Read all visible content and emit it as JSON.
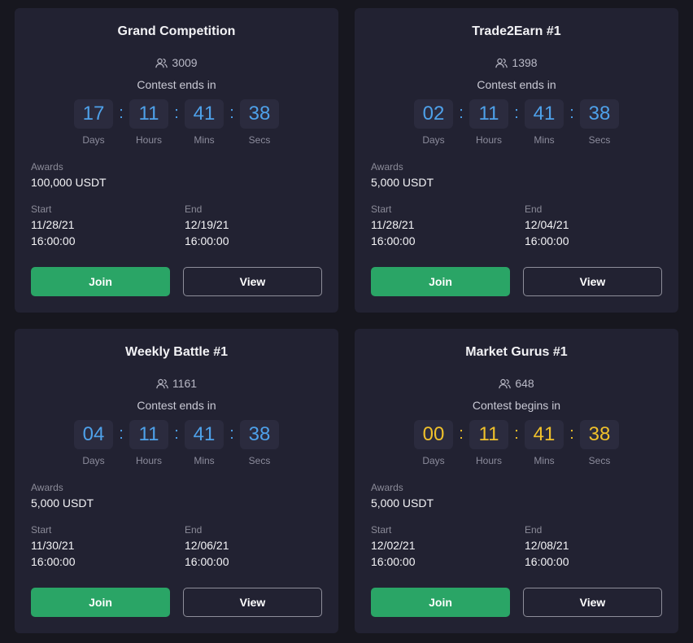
{
  "labels": {
    "awards": "Awards",
    "start": "Start",
    "end": "End",
    "days": "Days",
    "hours": "Hours",
    "mins": "Mins",
    "secs": "Secs",
    "join": "Join",
    "view": "View",
    "separator": ":"
  },
  "colors": {
    "background": "#17171f",
    "card": "#222232",
    "timer_box": "#2b2b3e",
    "countdown_blue": "#4ea1ea",
    "countdown_yellow": "#f0c12b",
    "join_button": "#2aa566"
  },
  "icons": {
    "participants": "users-icon"
  },
  "contests": [
    {
      "title": "Grand Competition",
      "participants": "3009",
      "status": "Contest ends in",
      "countdown_color": "blue",
      "countdown": {
        "days": "17",
        "hours": "11",
        "mins": "41",
        "secs": "38"
      },
      "awards": "100,000 USDT",
      "start_date": "11/28/21",
      "start_time": "16:00:00",
      "end_date": "12/19/21",
      "end_time": "16:00:00"
    },
    {
      "title": "Trade2Earn #1",
      "participants": "1398",
      "status": "Contest ends in",
      "countdown_color": "blue",
      "countdown": {
        "days": "02",
        "hours": "11",
        "mins": "41",
        "secs": "38"
      },
      "awards": "5,000 USDT",
      "start_date": "11/28/21",
      "start_time": "16:00:00",
      "end_date": "12/04/21",
      "end_time": "16:00:00"
    },
    {
      "title": "Weekly Battle #1",
      "participants": "1161",
      "status": "Contest ends in",
      "countdown_color": "blue",
      "countdown": {
        "days": "04",
        "hours": "11",
        "mins": "41",
        "secs": "38"
      },
      "awards": "5,000 USDT",
      "start_date": "11/30/21",
      "start_time": "16:00:00",
      "end_date": "12/06/21",
      "end_time": "16:00:00"
    },
    {
      "title": "Market Gurus #1",
      "participants": "648",
      "status": "Contest begins in",
      "countdown_color": "yellow",
      "countdown": {
        "days": "00",
        "hours": "11",
        "mins": "41",
        "secs": "38"
      },
      "awards": "5,000 USDT",
      "start_date": "12/02/21",
      "start_time": "16:00:00",
      "end_date": "12/08/21",
      "end_time": "16:00:00"
    }
  ]
}
